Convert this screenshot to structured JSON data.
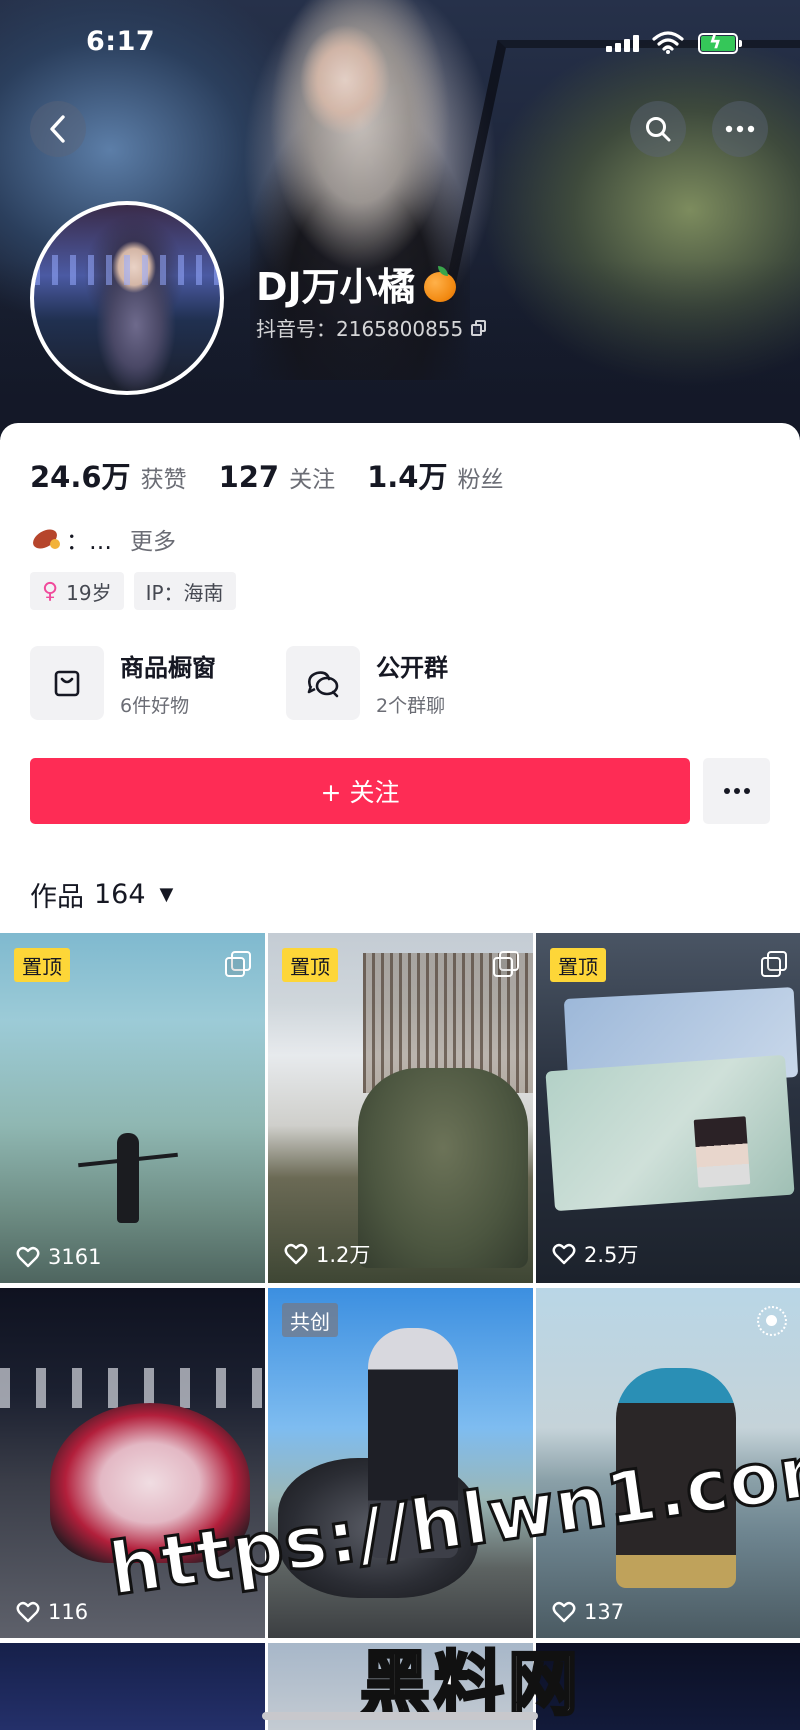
{
  "status_bar": {
    "time": "6:17"
  },
  "profile": {
    "name": "DJ万小橘",
    "name_emoji_icon": "orange-icon",
    "douyin_id": "抖音号：2165800855",
    "stats": [
      {
        "value": "24.6万",
        "label": "获赞"
      },
      {
        "value": "127",
        "label": "关注"
      },
      {
        "value": "1.4万",
        "label": "粉丝"
      }
    ],
    "bio": {
      "text": "：…",
      "more": "更多",
      "icon": "sweet-potato-icon"
    },
    "tags": {
      "age": "19岁",
      "ip": "IP：海南"
    }
  },
  "features": [
    {
      "title": "商品橱窗",
      "subtitle": "6件好物",
      "icon": "shopping-bag-icon"
    },
    {
      "title": "公开群",
      "subtitle": "2个群聊",
      "icon": "group-chat-icon"
    }
  ],
  "actions": {
    "follow_label": "+ 关注"
  },
  "works": {
    "label": "作品",
    "count": "164"
  },
  "grid": {
    "pin_label": "置顶",
    "collab_label": "共创",
    "likes": [
      "3161",
      "1.2万",
      "2.5万",
      "116",
      "",
      "137"
    ]
  },
  "watermark": {
    "url": "https://hlwn1.com",
    "name": "黑料网"
  },
  "colors": {
    "accent": "#fe2c55",
    "pin_badge": "#fdd638"
  }
}
